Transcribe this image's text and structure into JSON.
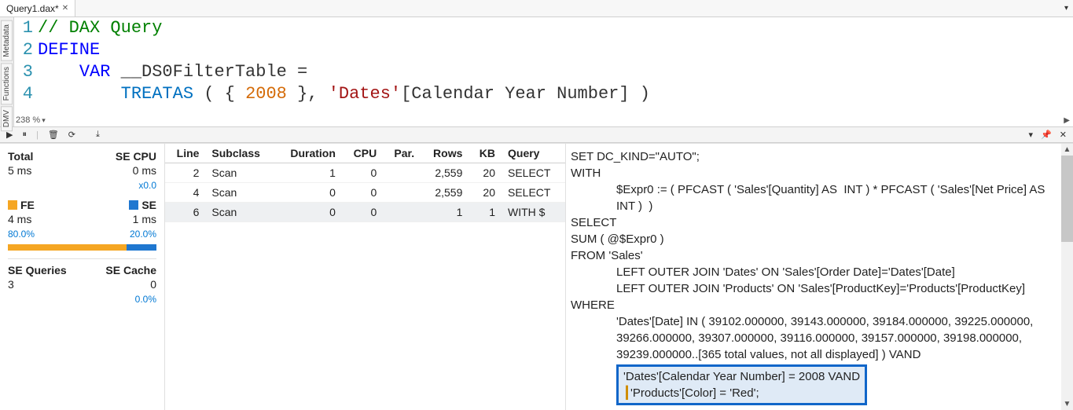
{
  "tab": {
    "title": "Query1.dax*",
    "dropdown_glyph": "▾"
  },
  "siderail": {
    "items": [
      "Metadata",
      "Functions",
      "DMV"
    ]
  },
  "editor": {
    "zoom": "238 %",
    "lines": [
      {
        "n": 1,
        "tokens": [
          {
            "cls": "tk-comment",
            "t": "// DAX Query"
          }
        ]
      },
      {
        "n": 2,
        "tokens": [
          {
            "cls": "tk-kw",
            "t": "DEFINE"
          }
        ]
      },
      {
        "n": 3,
        "tokens": [
          {
            "cls": "tk-norm",
            "t": "    "
          },
          {
            "cls": "tk-kw",
            "t": "VAR"
          },
          {
            "cls": "tk-norm",
            "t": " __DS0FilterTable ="
          }
        ]
      },
      {
        "n": 4,
        "tokens": [
          {
            "cls": "tk-norm",
            "t": "        "
          },
          {
            "cls": "tk-func",
            "t": "TREATAS"
          },
          {
            "cls": "tk-norm",
            "t": " ( { "
          },
          {
            "cls": "tk-num",
            "t": "2008"
          },
          {
            "cls": "tk-norm",
            "t": " }, "
          },
          {
            "cls": "tk-str",
            "t": "'Dates'"
          },
          {
            "cls": "tk-norm",
            "t": "[Calendar Year Number] )"
          }
        ]
      }
    ]
  },
  "midbar": {
    "play": "▶",
    "pause": "⏸",
    "clear": "🗑",
    "refresh": "⟳",
    "export": "⤓",
    "pin": "📌",
    "close": "✕",
    "dropdown": "▾"
  },
  "stats": {
    "total_label": "Total",
    "total_val": "5 ms",
    "secpu_label": "SE CPU",
    "secpu_val": "0 ms",
    "secpu_mult": "x0.0",
    "fe_label": "FE",
    "se_label": "SE",
    "fe_val": "4 ms",
    "se_val": "1 ms",
    "fe_pct": "80.0%",
    "se_pct": "20.0%",
    "fe_pct_num": 80,
    "se_pct_num": 20,
    "seq_label": "SE Queries",
    "seq_val": "3",
    "sec_label": "SE Cache",
    "sec_val": "0",
    "sec_pct": "0.0%"
  },
  "scan": {
    "cols": [
      "Line",
      "Subclass",
      "Duration",
      "CPU",
      "Par.",
      "Rows",
      "KB",
      "Query"
    ],
    "rows": [
      {
        "line": "2",
        "subclass": "Scan",
        "duration": "1",
        "cpu": "0",
        "par": "",
        "rows": "2,559",
        "kb": "20",
        "query": "SELECT",
        "sel": false
      },
      {
        "line": "4",
        "subclass": "Scan",
        "duration": "0",
        "cpu": "0",
        "par": "",
        "rows": "2,559",
        "kb": "20",
        "query": "SELECT",
        "sel": false
      },
      {
        "line": "6",
        "subclass": "Scan",
        "duration": "0",
        "cpu": "0",
        "par": "",
        "rows": "1",
        "kb": "1",
        "query": "WITH $",
        "sel": true
      }
    ]
  },
  "xmsql": {
    "lines": [
      "SET DC_KIND=\"AUTO\";",
      "WITH",
      "    $Expr0 := ( PFCAST ( 'Sales'[Quantity] AS  INT ) * PFCAST ( 'Sales'[Net Price] AS INT )  )",
      "SELECT",
      "SUM ( @$Expr0 )",
      "FROM 'Sales'",
      "    LEFT OUTER JOIN 'Dates' ON 'Sales'[Order Date]='Dates'[Date]",
      "    LEFT OUTER JOIN 'Products' ON 'Sales'[ProductKey]='Products'[ProductKey]",
      "WHERE",
      "    'Dates'[Date] IN ( 39102.000000, 39143.000000, 39184.000000, 39225.000000, 39266.000000, 39307.000000, 39116.000000, 39157.000000, 39198.000000, 39239.000000..[365 total values, not all displayed] ) VAND"
    ],
    "highlight": [
      "'Dates'[Calendar Year Number] = 2008 VAND",
      "'Products'[Color] = 'Red';"
    ]
  }
}
